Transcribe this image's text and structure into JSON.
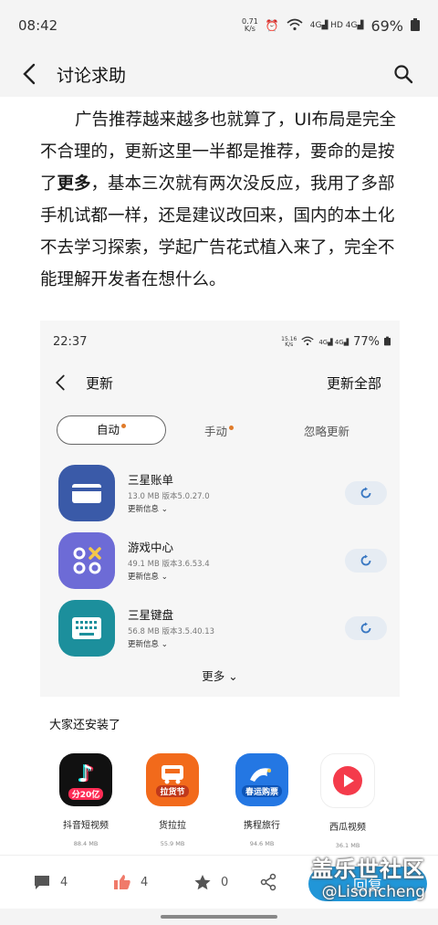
{
  "status_bar": {
    "time": "08:42",
    "speed": "0.71\nK/s",
    "network": "4G HD 4G",
    "battery": "69%"
  },
  "app_bar": {
    "title": "讨论求助"
  },
  "post": {
    "text_part1": "广告推荐越来越多也就算了，UI布局是完全不合理的，更新这里一半都是推荐，要命的是按了",
    "text_bold": "更多",
    "text_part2": "，基本三次就有两次没反应，我用了多部手机试都一样，还是建议改回来，国内的本土化不去学习探索，学起广告花式植入来了，完全不能理解开发者在想什么。"
  },
  "screenshot": {
    "status": {
      "time": "22:37",
      "speed": "15.16\nK/s",
      "battery": "77%"
    },
    "title": "更新",
    "update_all": "更新全部",
    "tabs": [
      {
        "label": "自动"
      },
      {
        "label": "手动"
      },
      {
        "label": "忽略更新"
      }
    ],
    "apps": [
      {
        "name": "三星账单",
        "meta": "13.0 MB  版本5.0.27.0",
        "info": "更新信息",
        "color": "#3a5aa8"
      },
      {
        "name": "游戏中心",
        "meta": "49.1 MB  版本3.6.53.4",
        "info": "更新信息",
        "color": "#6d6bd6"
      },
      {
        "name": "三星键盘",
        "meta": "56.8 MB  版本3.5.40.13",
        "info": "更新信息",
        "color": "#1c8f9c"
      }
    ],
    "more": "更多",
    "recommend_title": "大家还安装了",
    "recommend": [
      {
        "name": "抖音短视频",
        "size": "88.4 MB",
        "badge": "分20亿",
        "color": "#111111"
      },
      {
        "name": "货拉拉",
        "size": "55.9 MB",
        "badge": "拉货节",
        "color": "#f26a1b"
      },
      {
        "name": "携程旅行",
        "size": "94.6 MB",
        "badge": "春运购票",
        "color": "#2477e3"
      },
      {
        "name": "西瓜视频",
        "size": "36.1 MB",
        "badge": "",
        "color": "#f43b4b"
      }
    ]
  },
  "bottom_bar": {
    "comments": "4",
    "likes": "4",
    "favorites": "0",
    "reply": "回复"
  },
  "watermark": {
    "line1": "盖乐世社区",
    "line2": "@Lisoncheng"
  }
}
